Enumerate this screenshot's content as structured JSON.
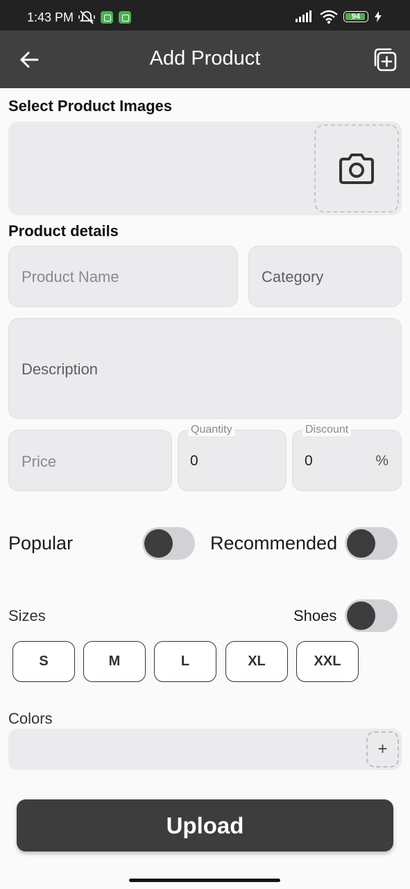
{
  "status_bar": {
    "time": "1:43 PM",
    "battery": "94",
    "battery_level": 0.94,
    "icons": [
      "mute-icon",
      "app-notification-icon",
      "app-notification-icon",
      "signal-icon",
      "wifi-icon",
      "battery-icon",
      "charging-icon"
    ]
  },
  "app_bar": {
    "title": "Add Product",
    "back_icon": "arrow-left-icon",
    "action_icon": "add-copy-icon",
    "background": "#404040"
  },
  "images_section": {
    "title": "Select Product Images",
    "camera_icon": "camera-icon"
  },
  "details_section": {
    "title": "Product details",
    "product_name": {
      "placeholder": "Product Name",
      "value": ""
    },
    "category": {
      "placeholder": "Category",
      "value": ""
    },
    "description": {
      "placeholder": "Description",
      "value": ""
    },
    "price": {
      "placeholder": "Price",
      "value": ""
    },
    "quantity": {
      "label": "Quantity",
      "value": "0"
    },
    "discount": {
      "label": "Discount",
      "value": "0",
      "suffix": "%"
    }
  },
  "toggles": {
    "popular": {
      "label": "Popular",
      "on": false
    },
    "recommended": {
      "label": "Recommended",
      "on": false
    },
    "shoes": {
      "label": "Shoes",
      "on": false
    }
  },
  "sizes": {
    "label": "Sizes",
    "options": [
      "S",
      "M",
      "L",
      "XL",
      "XXL"
    ]
  },
  "colors": {
    "label": "Colors",
    "add_label": "+"
  },
  "upload": {
    "label": "Upload"
  },
  "theme": {
    "accent": "#3d3d3d",
    "field_bg": "#ebebed",
    "battery_green": "#4caf50"
  }
}
